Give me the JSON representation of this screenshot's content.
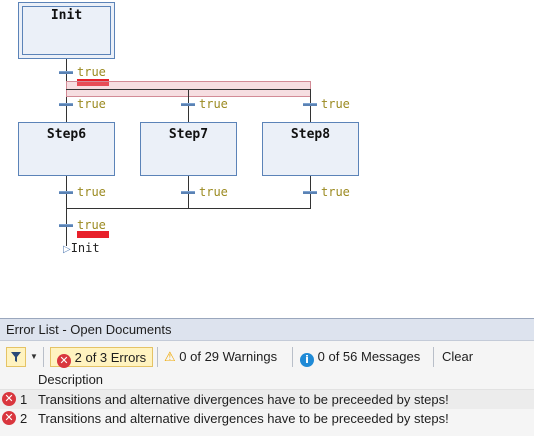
{
  "sfc": {
    "init_step": "Init",
    "steps": [
      "Step6",
      "Step7",
      "Step8"
    ],
    "transition_label": "true",
    "jump_target": "Init",
    "jump_arrow": "▷"
  },
  "error_list": {
    "title": "Error List - Open Documents",
    "filter_icon": "filter-icon",
    "errors_label": "2 of 3 Errors",
    "warnings_label": "0 of 29 Warnings",
    "messages_label": "0 of 56 Messages",
    "clear_label": "Clear",
    "column_description": "Description",
    "rows": [
      {
        "num": "1",
        "description": "Transitions and alternative divergences have to be preceeded by steps!"
      },
      {
        "num": "2",
        "description": "Transitions and alternative divergences have to be preceeded by steps!"
      }
    ],
    "colors": {
      "error": "#d9363e",
      "warning": "#f0a800",
      "info": "#1f8ad6"
    }
  }
}
